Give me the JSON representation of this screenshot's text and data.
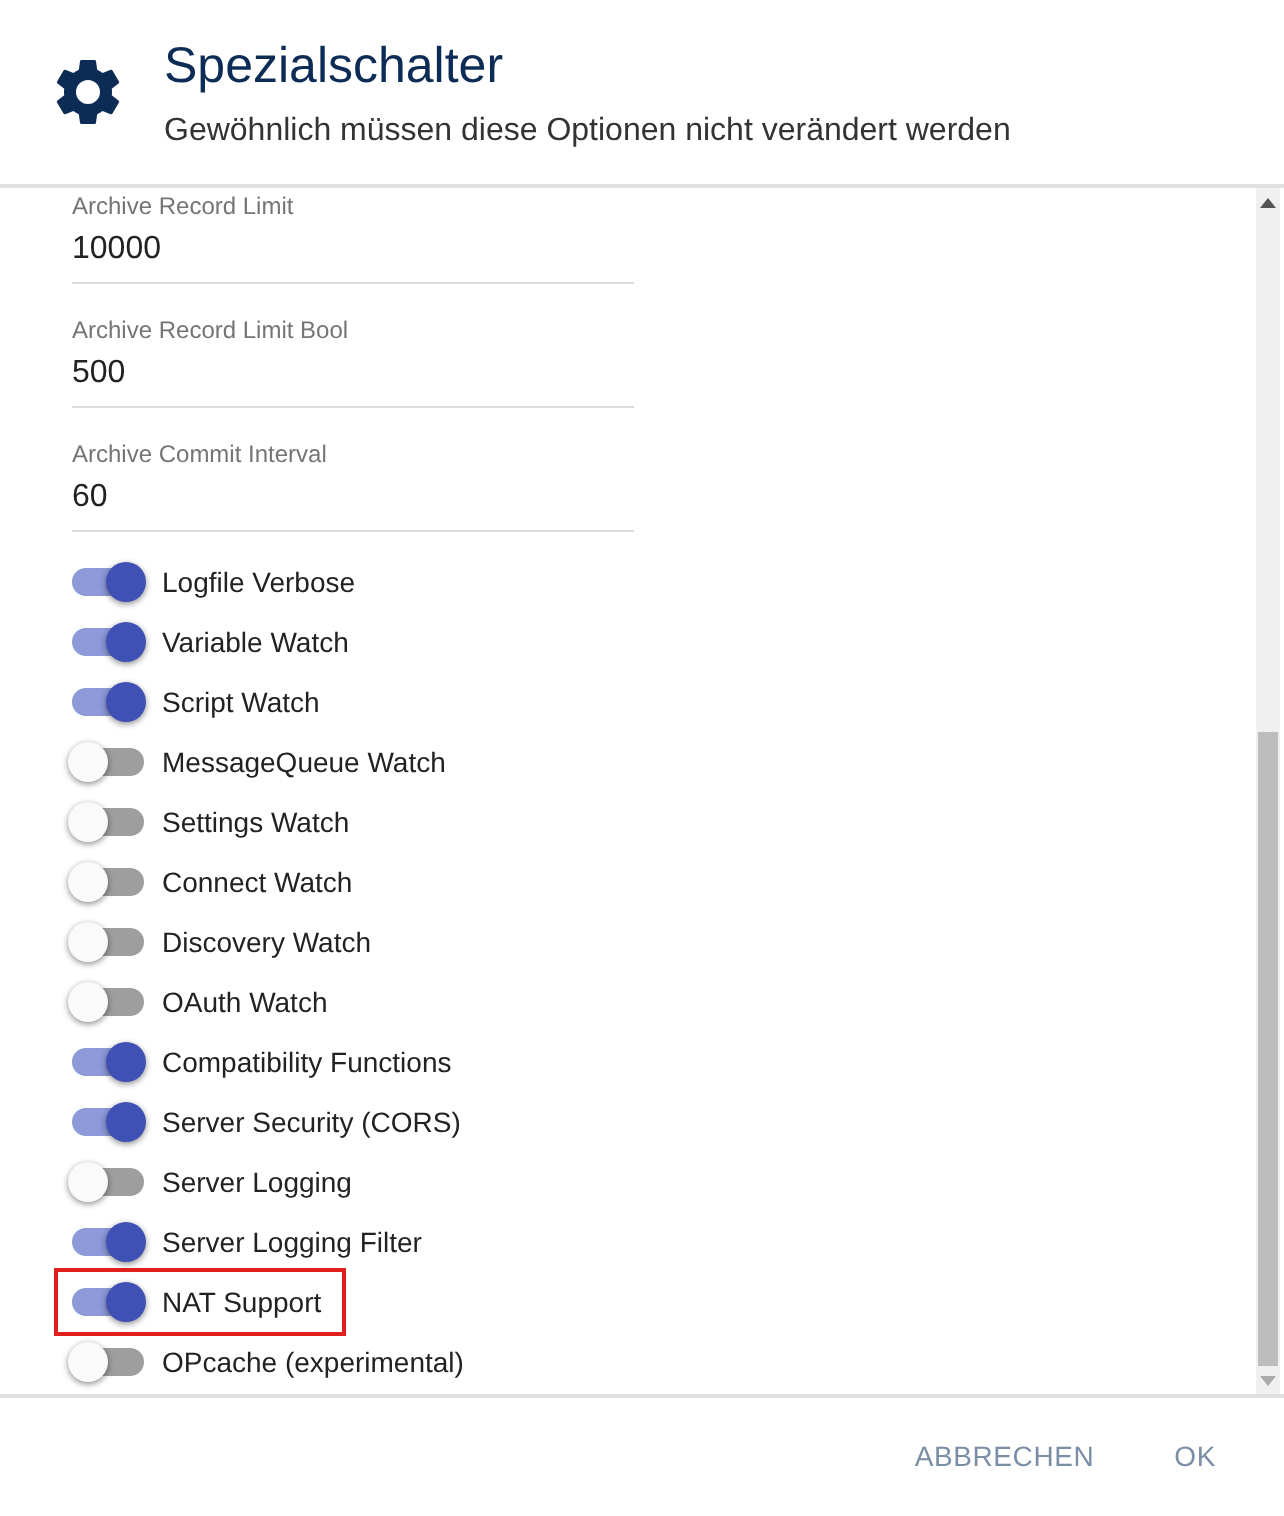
{
  "header": {
    "title": "Spezialschalter",
    "subtitle": "Gewöhnlich müssen diese Optionen nicht verändert werden"
  },
  "fields": [
    {
      "label": "Archive Record Limit",
      "value": "10000"
    },
    {
      "label": "Archive Record Limit Bool",
      "value": "500"
    },
    {
      "label": "Archive Commit Interval",
      "value": "60"
    }
  ],
  "switches": [
    {
      "label": "Logfile Verbose",
      "on": true,
      "highlighted": false
    },
    {
      "label": "Variable Watch",
      "on": true,
      "highlighted": false
    },
    {
      "label": "Script Watch",
      "on": true,
      "highlighted": false
    },
    {
      "label": "MessageQueue Watch",
      "on": false,
      "highlighted": false
    },
    {
      "label": "Settings Watch",
      "on": false,
      "highlighted": false
    },
    {
      "label": "Connect Watch",
      "on": false,
      "highlighted": false
    },
    {
      "label": "Discovery Watch",
      "on": false,
      "highlighted": false
    },
    {
      "label": "OAuth Watch",
      "on": false,
      "highlighted": false
    },
    {
      "label": "Compatibility Functions",
      "on": true,
      "highlighted": false
    },
    {
      "label": "Server Security (CORS)",
      "on": true,
      "highlighted": false
    },
    {
      "label": "Server Logging",
      "on": false,
      "highlighted": false
    },
    {
      "label": "Server Logging Filter",
      "on": true,
      "highlighted": false
    },
    {
      "label": "NAT Support",
      "on": true,
      "highlighted": true
    },
    {
      "label": "OPcache (experimental)",
      "on": false,
      "highlighted": false
    }
  ],
  "buttons": [
    {
      "label": "ABBRECHEN"
    },
    {
      "label": "OK"
    }
  ]
}
